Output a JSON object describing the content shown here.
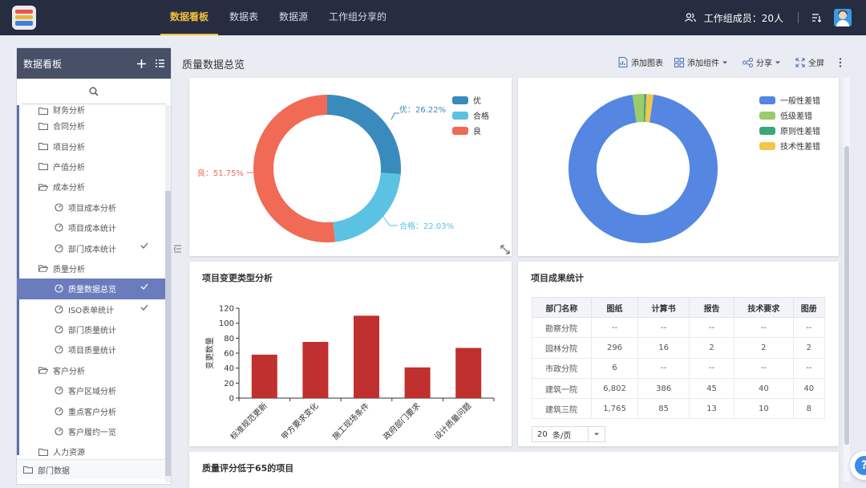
{
  "topbar": {
    "tabs": [
      "数据看板",
      "数据表",
      "数据源",
      "工作组分享的"
    ],
    "members": "工作组成员：20人"
  },
  "sidebar": {
    "title": "数据看板",
    "items": [
      {
        "label": "财务分析",
        "level": 1,
        "type": "folder",
        "partial": true
      },
      {
        "label": "合同分析",
        "level": 1,
        "type": "folder"
      },
      {
        "label": "项目分析",
        "level": 1,
        "type": "folder"
      },
      {
        "label": "产值分析",
        "level": 1,
        "type": "folder"
      },
      {
        "label": "成本分析",
        "level": 1,
        "type": "folder-open"
      },
      {
        "label": "项目成本分析",
        "level": 2,
        "type": "dash"
      },
      {
        "label": "项目成本统计",
        "level": 2,
        "type": "dash"
      },
      {
        "label": "部门成本统计",
        "level": 2,
        "type": "dash",
        "checked": true
      },
      {
        "label": "质量分析",
        "level": 1,
        "type": "folder-open"
      },
      {
        "label": "质量数据总览",
        "level": 2,
        "type": "dash",
        "checked": true,
        "selected": true
      },
      {
        "label": "ISO表单统计",
        "level": 2,
        "type": "dash",
        "checked": true
      },
      {
        "label": "部门质量统计",
        "level": 2,
        "type": "dash"
      },
      {
        "label": "项目质量统计",
        "level": 2,
        "type": "dash"
      },
      {
        "label": "客户分析",
        "level": 1,
        "type": "folder-open"
      },
      {
        "label": "客户区域分析",
        "level": 2,
        "type": "dash"
      },
      {
        "label": "重点客户分析",
        "level": 2,
        "type": "dash"
      },
      {
        "label": "客户履约一览",
        "level": 2,
        "type": "dash"
      },
      {
        "label": "人力资源",
        "level": 1,
        "type": "folder"
      },
      {
        "label": "部门数据",
        "level": 0,
        "type": "folder",
        "last": true
      }
    ]
  },
  "page": {
    "title": "质量数据总览",
    "toolbar": {
      "add_chart": "添加图表",
      "add_widget": "添加组件",
      "share": "分享",
      "fullscreen": "全屏"
    }
  },
  "colors": {
    "accent": "#f2c03e",
    "topbar": "#262d40",
    "bar": "#c0302e",
    "selected": "#6b7cbd"
  },
  "chart_data": [
    {
      "type": "pie",
      "categories": [
        "优",
        "合格",
        "良"
      ],
      "values": [
        26.22,
        22.03,
        51.75
      ],
      "colors": [
        "#3a8bbd",
        "#5bc2e4",
        "#f06a55"
      ],
      "labels": [
        "优：26.22%",
        "合格：22.03%",
        "良：51.75%"
      ],
      "legend": "top-right"
    },
    {
      "type": "pie",
      "categories": [
        "一般性差错",
        "低级差错",
        "原则性差错",
        "技术性差错"
      ],
      "values": [
        95.5,
        2.5,
        0.5,
        1.5
      ],
      "colors": [
        "#5486e2",
        "#9ccb6a",
        "#3aa67b",
        "#f3c64a"
      ],
      "legend": "top-right"
    },
    {
      "type": "bar",
      "title": "项目变更类型分析",
      "categories": [
        "标准规范更新",
        "甲方要求变化",
        "施工现场条件",
        "政府部门要求",
        "设计质量问题"
      ],
      "values": [
        58,
        75,
        110,
        41,
        67
      ],
      "ylabel": "变更数量",
      "ylim": [
        0,
        120
      ],
      "yticks": [
        "0",
        "20",
        "40",
        "60",
        "80",
        "100",
        "120"
      ],
      "color": "#c0302e"
    }
  ],
  "table": {
    "title": "项目成果统计",
    "headers": [
      "部门名称",
      "图纸",
      "计算书",
      "报告",
      "技术要求",
      "图册"
    ],
    "rows": [
      [
        "勘察分院",
        "--",
        "--",
        "--",
        "--",
        "--"
      ],
      [
        "园林分院",
        "296",
        "16",
        "2",
        "2",
        "2"
      ],
      [
        "市政分院",
        "6",
        "--",
        "--",
        "--",
        "--"
      ],
      [
        "建筑一院",
        "6,802",
        "386",
        "45",
        "40",
        "40"
      ],
      [
        "建筑三院",
        "1,765",
        "85",
        "13",
        "10",
        "8"
      ]
    ],
    "page_size": "20",
    "page_unit": "条/页"
  },
  "bottom_card": {
    "title": "质量评分低于65的项目"
  }
}
